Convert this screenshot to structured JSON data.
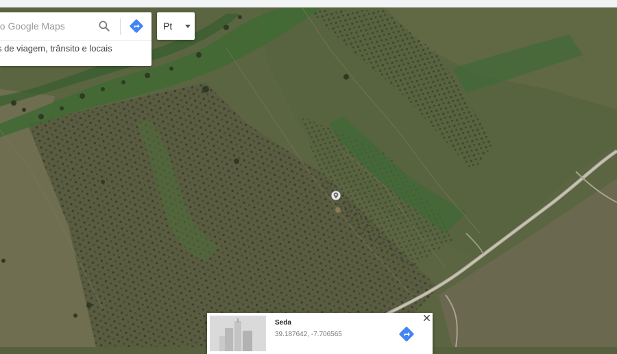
{
  "search": {
    "placeholder": "no Google Maps",
    "hint": "s de viagem, trânsito e locais",
    "icon": "search-icon",
    "directions_icon": "directions-icon",
    "accent": "#4285f4"
  },
  "language": {
    "label": "Pt",
    "caret_icon": "caret-down-icon"
  },
  "map": {
    "type": "satellite",
    "pin_icon": "place-pin-icon"
  },
  "place": {
    "title": "Seda",
    "coordinates": "39.187642, -7.706565",
    "thumbnail": "building-thumbnail",
    "directions_icon": "directions-icon",
    "close_icon": "close-icon"
  }
}
